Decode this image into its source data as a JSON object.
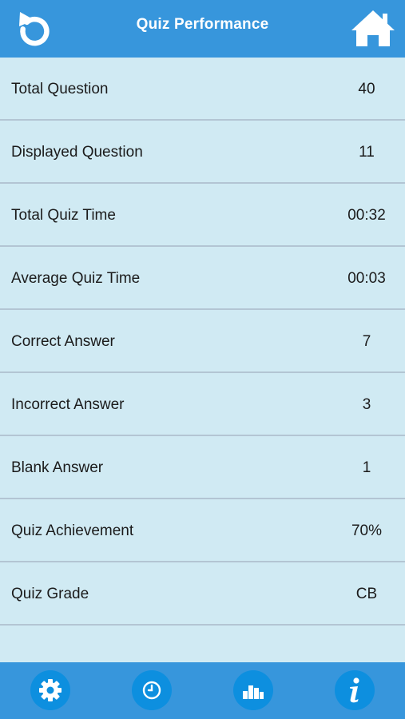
{
  "header": {
    "title": "Quiz Performance",
    "back_icon": "undo-arrow-icon",
    "home_icon": "home-icon"
  },
  "stats": [
    {
      "label": "Total Question",
      "value": "40"
    },
    {
      "label": "Displayed Question",
      "value": "11"
    },
    {
      "label": "Total Quiz Time",
      "value": "00:32"
    },
    {
      "label": "Average Quiz Time",
      "value": "00:03"
    },
    {
      "label": "Correct Answer",
      "value": "7"
    },
    {
      "label": "Incorrect Answer",
      "value": "3"
    },
    {
      "label": "Blank Answer",
      "value": "1"
    },
    {
      "label": "Quiz Achievement",
      "value": "70%"
    },
    {
      "label": "Quiz Grade",
      "value": "CB"
    }
  ],
  "tabbar": {
    "items": [
      "gear-icon",
      "clock-icon",
      "bar-chart-icon",
      "info-icon"
    ]
  },
  "colors": {
    "header_bg": "#3796dc",
    "list_bg": "#d0eaf3",
    "divider": "#b3c5d3",
    "tab_circle": "#0d8fdf"
  }
}
